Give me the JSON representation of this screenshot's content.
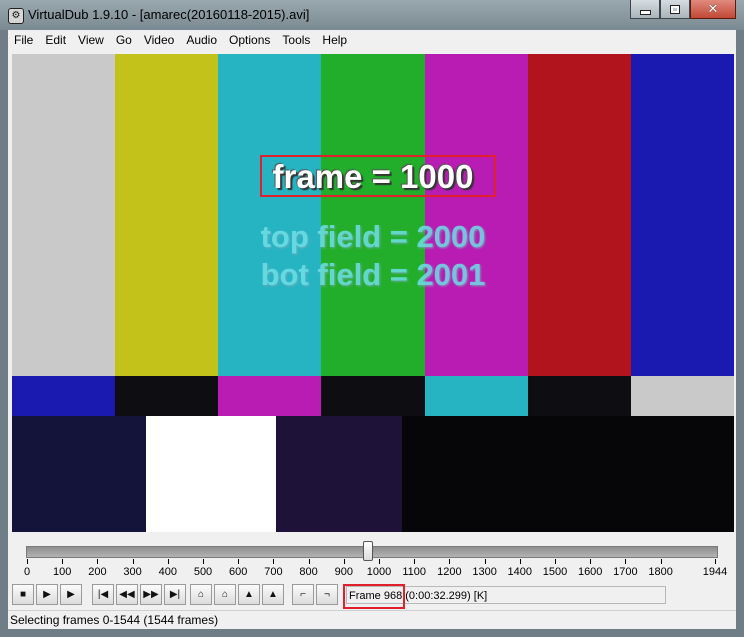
{
  "window": {
    "title": "VirtualDub 1.9.10 - [amarec(20160118-2015).avi]",
    "minimize_label": "",
    "maximize_label": "",
    "close_label": "✕"
  },
  "menu": [
    "File",
    "Edit",
    "View",
    "Go",
    "Video",
    "Audio",
    "Options",
    "Tools",
    "Help"
  ],
  "video": {
    "frame_text": "frame = 1000",
    "top_field_text": "top field = 2000",
    "bot_field_text": "bot field = 2001",
    "bars_top_colors": [
      "#c9c9c9",
      "#c2c21a",
      "#26b4c2",
      "#22ae2a",
      "#b81cb2",
      "#b1141c",
      "#1a1ab0"
    ],
    "bars_mid_colors": [
      "#1a1ab0",
      "#0d0d12",
      "#b81cb2",
      "#0d0d12",
      "#26b4c2",
      "#0d0d12",
      "#c9c9c9"
    ]
  },
  "slider": {
    "tick_labels": [
      "0",
      "100",
      "200",
      "300",
      "400",
      "500",
      "600",
      "700",
      "800",
      "900",
      "1000",
      "1100",
      "1200",
      "1300",
      "1400",
      "1500",
      "1600",
      "1700",
      "1800",
      "1944"
    ],
    "position_frame": 968,
    "total_frames": 1944
  },
  "toolbar": {
    "buttons": [
      {
        "name": "stop-button",
        "icon": "■"
      },
      {
        "name": "play-input-button",
        "icon": "▶"
      },
      {
        "name": "play-output-button",
        "icon": "▶"
      },
      {
        "name": "go-start-button",
        "icon": "|◀"
      },
      {
        "name": "prev-frame-button",
        "icon": "◀◀"
      },
      {
        "name": "next-frame-button",
        "icon": "▶▶"
      },
      {
        "name": "go-end-button",
        "icon": "▶|"
      },
      {
        "name": "prev-keyframe-button",
        "icon": "⌂"
      },
      {
        "name": "next-keyframe-button",
        "icon": "⌂"
      },
      {
        "name": "prev-scene-button",
        "icon": "▲"
      },
      {
        "name": "next-scene-button",
        "icon": "▲"
      },
      {
        "name": "mark-in-button",
        "icon": "⌐"
      },
      {
        "name": "mark-out-button",
        "icon": "¬"
      }
    ],
    "frame_label": "Frame 968",
    "frame_time": "(0:00:32.299) [K]"
  },
  "status": {
    "text": "Selecting frames 0-1544 (1544 frames)"
  }
}
